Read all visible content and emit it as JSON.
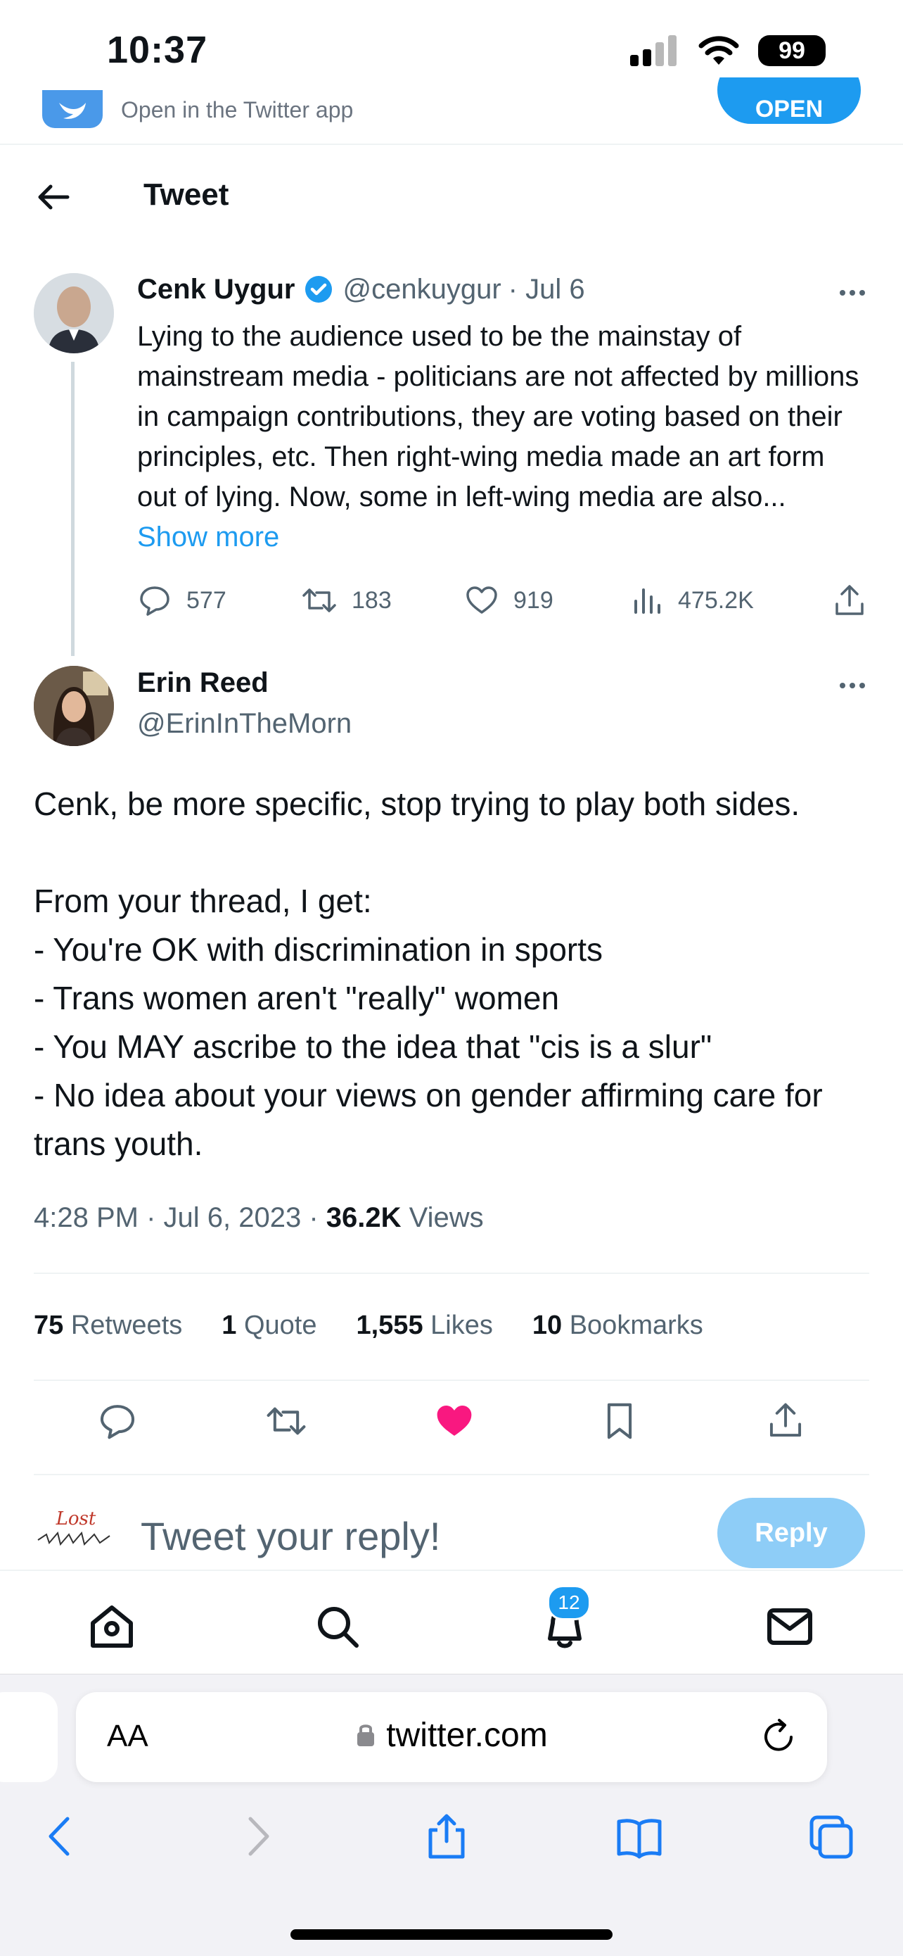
{
  "status_bar": {
    "time": "10:37",
    "battery": "99"
  },
  "app_banner": {
    "text": "Open in the Twitter app",
    "open_label": "OPEN"
  },
  "header": {
    "title": "Tweet"
  },
  "parent_tweet": {
    "name": "Cenk Uygur",
    "handle": "@cenkuygur",
    "date": "· Jul 6",
    "text": "Lying to the audience used to be the mainstay of mainstream media - politicians are not affected by millions in campaign contributions, they are voting based on their principles, etc. Then right-wing media made an art form out of lying. Now, some in left-wing media are also...",
    "show_more": "Show more",
    "replies": "577",
    "retweets": "183",
    "likes": "919",
    "views": "475.2K"
  },
  "main_tweet": {
    "name": "Erin Reed",
    "handle": "@ErinInTheMorn",
    "lines": [
      "Cenk, be more specific, stop trying to play both sides.",
      "",
      "From your thread, I get:",
      "- You're OK with discrimination in sports",
      "- Trans women aren't \"really\" women",
      "- You MAY ascribe to the idea that \"cis is a slur\"",
      "- No idea about your views on gender affirming care for trans youth."
    ],
    "timestamp": "4:28 PM · Jul 6, 2023 ·",
    "views_count": "36.2K",
    "views_label": "Views"
  },
  "stats": {
    "retweets_count": "75",
    "retweets_label": "Retweets",
    "quotes_count": "1",
    "quotes_label": "Quote",
    "likes_count": "1,555",
    "likes_label": "Likes",
    "bookmarks_count": "10",
    "bookmarks_label": "Bookmarks"
  },
  "reply_box": {
    "avatar_text": "Lost",
    "placeholder": "Tweet your reply!",
    "button": "Reply"
  },
  "tab_bar": {
    "notification_count": "12"
  },
  "safari": {
    "aa": "AA",
    "url": "twitter.com"
  },
  "colors": {
    "accent": "#1d9bf0",
    "like": "#f91880",
    "muted": "#536471"
  }
}
